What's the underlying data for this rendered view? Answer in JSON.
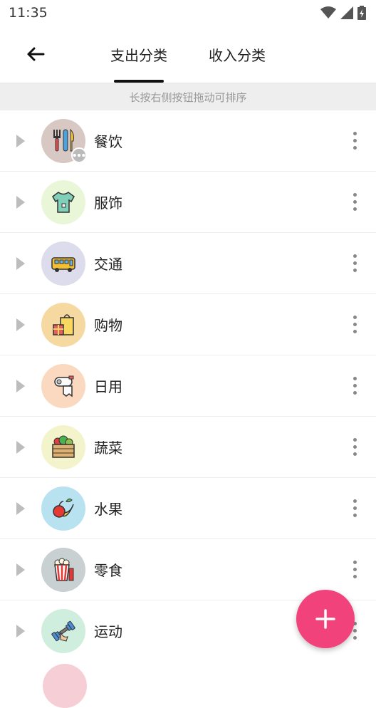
{
  "status_bar": {
    "time": "11:35",
    "icons": [
      "wifi-icon",
      "signal-icon",
      "battery-icon"
    ]
  },
  "header": {
    "back_icon": "arrow-left-icon",
    "tabs": [
      {
        "label": "支出分类",
        "active": true
      },
      {
        "label": "收入分类",
        "active": false
      }
    ]
  },
  "hint": "长按右侧按钮拖动可排序",
  "categories": [
    {
      "label": "餐饮",
      "bg": "#d8c8c4",
      "icon": "utensils-icon",
      "has_sub": true
    },
    {
      "label": "服饰",
      "bg": "#eaf6d8",
      "icon": "shirt-icon"
    },
    {
      "label": "交通",
      "bg": "#dcdcec",
      "icon": "bus-icon"
    },
    {
      "label": "购物",
      "bg": "#f6d9a0",
      "icon": "shopping-bag-icon"
    },
    {
      "label": "日用",
      "bg": "#fad9c0",
      "icon": "toilet-paper-icon"
    },
    {
      "label": "蔬菜",
      "bg": "#f4f4cc",
      "icon": "vegetable-crate-icon"
    },
    {
      "label": "水果",
      "bg": "#b8e2f0",
      "icon": "fruit-icon"
    },
    {
      "label": "零食",
      "bg": "#c8d0d2",
      "icon": "popcorn-icon"
    },
    {
      "label": "运动",
      "bg": "#cfeedd",
      "icon": "dumbbell-icon"
    }
  ],
  "colors": {
    "accent": "#f2427b",
    "hint_bg": "#eeeeee"
  },
  "fab_icon": "plus-icon"
}
